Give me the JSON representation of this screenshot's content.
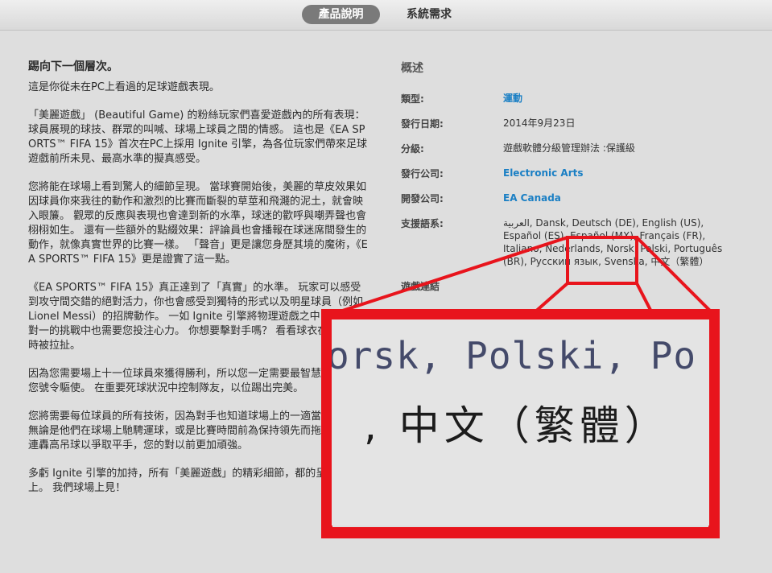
{
  "tabs": [
    {
      "label": "產品說明",
      "active": true
    },
    {
      "label": "系統需求",
      "active": false
    }
  ],
  "description": {
    "heading": "踢向下一個層次。",
    "paragraphs": [
      "這是你從未在PC上看過的足球遊戲表現。",
      "「美麗遊戲」 (Beautiful Game) 的粉絲玩家們喜愛遊戲內的所有表現：球員展現的球技、群眾的叫喊、球場上球員之間的情感。 這也是《EA SPORTS™ FIFA 15》首次在PC上採用 Ignite 引擎，為各位玩家們帶來足球遊戲前所未見、最高水準的擬真感受。",
      "您將能在球場上看到驚人的細節呈現。 當球賽開始後，美麗的草皮效果如因球員你來我往的動作和激烈的比賽而斷裂的草莖和飛濺的泥土，就會映入眼簾。 觀眾的反應與表現也會達到新的水準，球迷的歡呼與嘲弄聲也會栩栩如生。 還有一些額外的點綴效果：評論員也會播報在球迷席間發生的動作，就像真實世界的比賽一樣。 「聲音」更是讓您身歷其境的魔術，《EA SPORTS™ FIFA 15》更是證實了這一點。",
      "《EA SPORTS™ FIFA 15》真正達到了「真實」的水準。 玩家可以感受到攻守間交錯的絕對活力，你也會感受到獨特的形式以及明星球員（例如 Lionel Messi）的招牌動作。 一如 Ignite 引擎將物理遊戲之中，您在一對一的挑戰中也需要您投注心力。 你想要擊對手嗎？ 看看球衣在爭奪球權時被拉扯。",
      "因為您需要場上十一位球員來獲得勝利，所以您一定需要最智慧隊友，供您號令驅使。 在重要死球狀況中控制隊友，以位踢出完美。",
      "您將需要每位球員的所有技術，因為對手也知道球場上的一適當的反應。 無論是他們在球場上馳騁運球，或是比賽時間前為保持領先而拖延，或是連轟高吊球以爭取平手，您的對以前更加頑強。",
      "多虧 Ignite 引擎的加持，所有「美麗遊戲」的精彩細節，都的呈現在PC上。 我們球場上見！"
    ]
  },
  "overview": {
    "heading": "概述",
    "rows": [
      {
        "label": "類型:",
        "value": "運動",
        "link": true
      },
      {
        "label": "發行日期:",
        "value": "2014年9月23日",
        "link": false
      },
      {
        "label": "分級:",
        "value": "遊戲軟體分級管理辦法 :保護級",
        "link": false
      },
      {
        "label": "發行公司:",
        "value": "Electronic Arts",
        "link": true
      },
      {
        "label": "開發公司:",
        "value": "EA Canada",
        "link": true
      }
    ],
    "languages_label": "支援語系:",
    "languages_value": "العربية, Dansk, Deutsch (DE), English (US), Español (ES), Español (MX), Français (FR), Italiano, Nederlands, Norsk, Polski, Português (BR), Русский язык, Svenska, 中文（繁體）",
    "game_link_label": "遊戲連結"
  },
  "zoom": {
    "line1": "orsk, Polski, Po",
    "line2": ", 中文（繁體）"
  },
  "colors": {
    "callout": "#e8141c",
    "link": "#1a7fc4",
    "active_tab": "#7a7a7a"
  }
}
